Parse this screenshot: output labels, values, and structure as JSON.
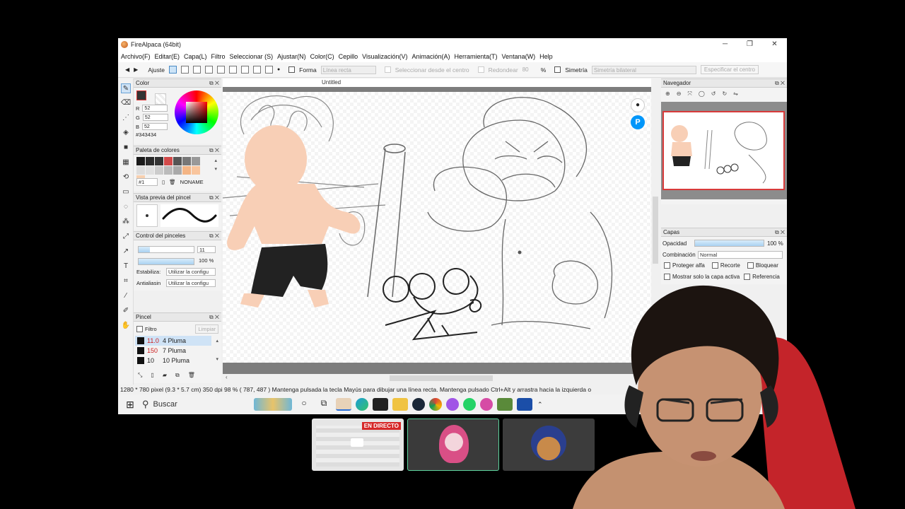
{
  "window": {
    "title": "FireAlpaca (64bit)",
    "controls": [
      "─",
      "❐",
      "✕"
    ]
  },
  "menu": [
    "Archivo(F)",
    "Editar(E)",
    "Capa(L)",
    "Filtro",
    "Seleccionar (S)",
    "Ajustar(N)",
    "Color(C)",
    "Cepillo",
    "Visualización(V)",
    "Animación(A)",
    "Herramienta(T)",
    "Ventana(W)",
    "Help"
  ],
  "toolbar": {
    "ajuste": "Ajuste",
    "forma": "Forma",
    "forma_value": "Línea recta",
    "select_center": "Seleccionar desde el centro",
    "redondear": "Redondear",
    "redondear_value": "80",
    "percent": "%",
    "simetria": "Simetría",
    "simetria_value": "Simetría bilateral",
    "specify_center": "Especificar el centro"
  },
  "color_panel": {
    "title": "Color",
    "r_label": "R",
    "r": "52",
    "g_label": "G",
    "g": "52",
    "b_label": "B",
    "b": "52",
    "hex": "#343434",
    "current": "#343434"
  },
  "palette_panel": {
    "title": "Paleta de colores",
    "slot": "#1",
    "name": "NONAME",
    "colors": [
      "#1a1a1a",
      "#2a2a2a",
      "#333333",
      "#d24a4a",
      "#555555",
      "#777777",
      "#999999",
      "#dddddd",
      "#e0e0e0",
      "#cccccc",
      "#bbbbbb",
      "#aaaaaa",
      "#f4b585",
      "#f9c59d",
      "#f8d0b0"
    ]
  },
  "brush_preview_panel": {
    "title": "Vista previa del pincel"
  },
  "brush_control_panel": {
    "title": "Control del pinceles",
    "size": "11",
    "opacity": "100 %",
    "opacity_fraction": 1.0,
    "stabilizer_label": "Estabiliza:",
    "stabilizer_value": "Utilizar la configu",
    "antialias_label": "Antialiasin",
    "antialias_value": "Utilizar la configu"
  },
  "brush_panel": {
    "title": "Pincel",
    "filter_label": "Filtro",
    "clear_label": "Limpiar",
    "items": [
      {
        "size": "11.0",
        "name": "4 Pluma"
      },
      {
        "size": "150",
        "name": "7 Pluma"
      },
      {
        "size": "10",
        "name": "10 Pluma"
      }
    ]
  },
  "canvas": {
    "tab": "Untitled"
  },
  "navigator": {
    "title": "Navegador"
  },
  "layers_panel": {
    "title": "Capas",
    "opacity_label": "Opacidad",
    "opacity": "100 %",
    "opacity_fraction": 1.0,
    "blend_label": "Combinación",
    "blend_value": "Normal",
    "protect_alpha": "Proteger alfa",
    "clip": "Recorte",
    "lock": "Bloquear",
    "show_active": "Mostrar solo la capa activa",
    "reference": "Referencia"
  },
  "status": {
    "dimensions": "1280 * 780 pixel",
    "cm": "(9.3 * 5.7 cm)",
    "dpi": "350 dpi",
    "zoom": "98 %",
    "cursor": "( 787, 487 )",
    "hint": "Mantenga pulsada la tecla Mayús para dibujar una línea recta. Mantenga pulsado Ctrl+Alt y arrastra hacia la izquierda o"
  },
  "taskbar": {
    "search_label": "Buscar"
  },
  "stream": {
    "live_label": "EN DIRECTO"
  }
}
